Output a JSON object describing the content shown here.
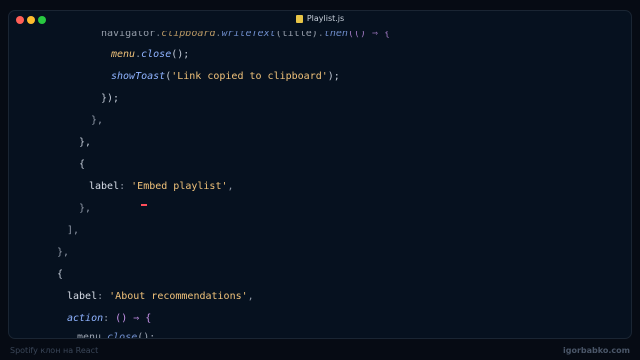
{
  "window": {
    "file_name": "Playlist.js",
    "file_icon": "js-file-icon"
  },
  "code": {
    "line_1": {
      "obj": "navigator",
      "dot1": ".",
      "prop": "clipboard",
      "dot2": ".",
      "method": "writeText",
      "args": "(title)",
      "dot3": ".",
      "then": "then",
      "tail": "(() ⇒ {"
    },
    "line_2": {
      "obj": "menu",
      "dot": ".",
      "method": "close",
      "tail": "();"
    },
    "line_3": {
      "fn": "showToast",
      "open": "(",
      "str": "'Link copied to clipboard'",
      "close": ");"
    },
    "line_4": "});",
    "line_5": "},",
    "line_6": "},",
    "line_7": "{",
    "line_8": {
      "key": "label",
      "colon": ": ",
      "str": "'Embed playlist'",
      "comma": ","
    },
    "line_9": "},",
    "line_10": "],",
    "line_11": "},",
    "line_12": "{",
    "line_13": {
      "key": "label",
      "colon": ": ",
      "str": "'About recommendations'",
      "comma": ","
    },
    "line_14": {
      "key": "action",
      "colon": ": ",
      "tail": "() ⇒ {"
    },
    "line_15": {
      "obj": "menu",
      "dot": ".",
      "method": "close",
      "tail": "();"
    }
  },
  "captions": {
    "left": "Spotify клон на React",
    "right": "igorbabko.com"
  }
}
